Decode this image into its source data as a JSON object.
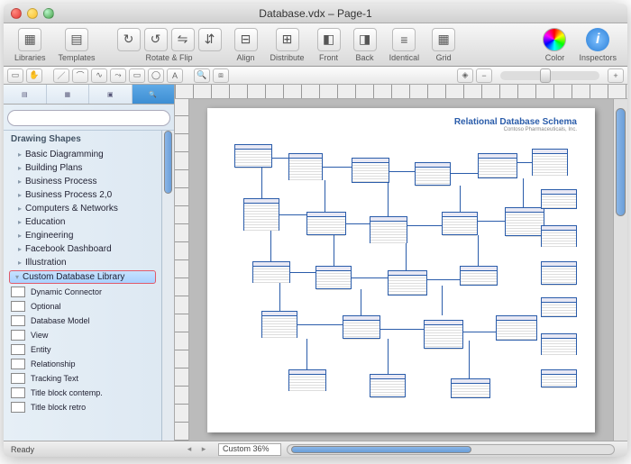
{
  "window": {
    "title": "Database.vdx – Page-1"
  },
  "toolbar": {
    "groups": [
      {
        "label": "Libraries",
        "icons": [
          "▦"
        ]
      },
      {
        "label": "Templates",
        "icons": [
          "▤"
        ]
      },
      {
        "label": "Rotate & Flip",
        "icons": [
          "↻",
          "↺",
          "⇋",
          "⇵"
        ]
      },
      {
        "label": "Align",
        "icons": [
          "⊟"
        ]
      },
      {
        "label": "Distribute",
        "icons": [
          "⊞"
        ]
      },
      {
        "label": "Front",
        "icons": [
          "◧"
        ]
      },
      {
        "label": "Back",
        "icons": [
          "◨"
        ]
      },
      {
        "label": "Identical",
        "icons": [
          "≡"
        ]
      },
      {
        "label": "Grid",
        "icons": [
          "▦"
        ]
      },
      {
        "label": "Color",
        "icons": [
          "color"
        ]
      },
      {
        "label": "Inspectors",
        "icons": [
          "info"
        ]
      }
    ]
  },
  "sidebar": {
    "header": "Drawing Shapes",
    "categories": [
      "Basic Diagramming",
      "Building Plans",
      "Business Process",
      "Business Process 2,0",
      "Computers & Networks",
      "Education",
      "Engineering",
      "Facebook Dashboard",
      "Illustration"
    ],
    "selected": "Custom Database Library",
    "stencils": [
      "Dynamic Connector",
      "Optional",
      "Database Model",
      "View",
      "Entity",
      "Relationship",
      "Tracking Text",
      "Title block contemp.",
      "Title block retro"
    ],
    "search_placeholder": ""
  },
  "diagram": {
    "title": "Relational Database Schema",
    "subtitle": "Contoso Pharmaceuticals, Inc."
  },
  "status": {
    "text": "Ready",
    "zoom": "Custom 36%"
  }
}
